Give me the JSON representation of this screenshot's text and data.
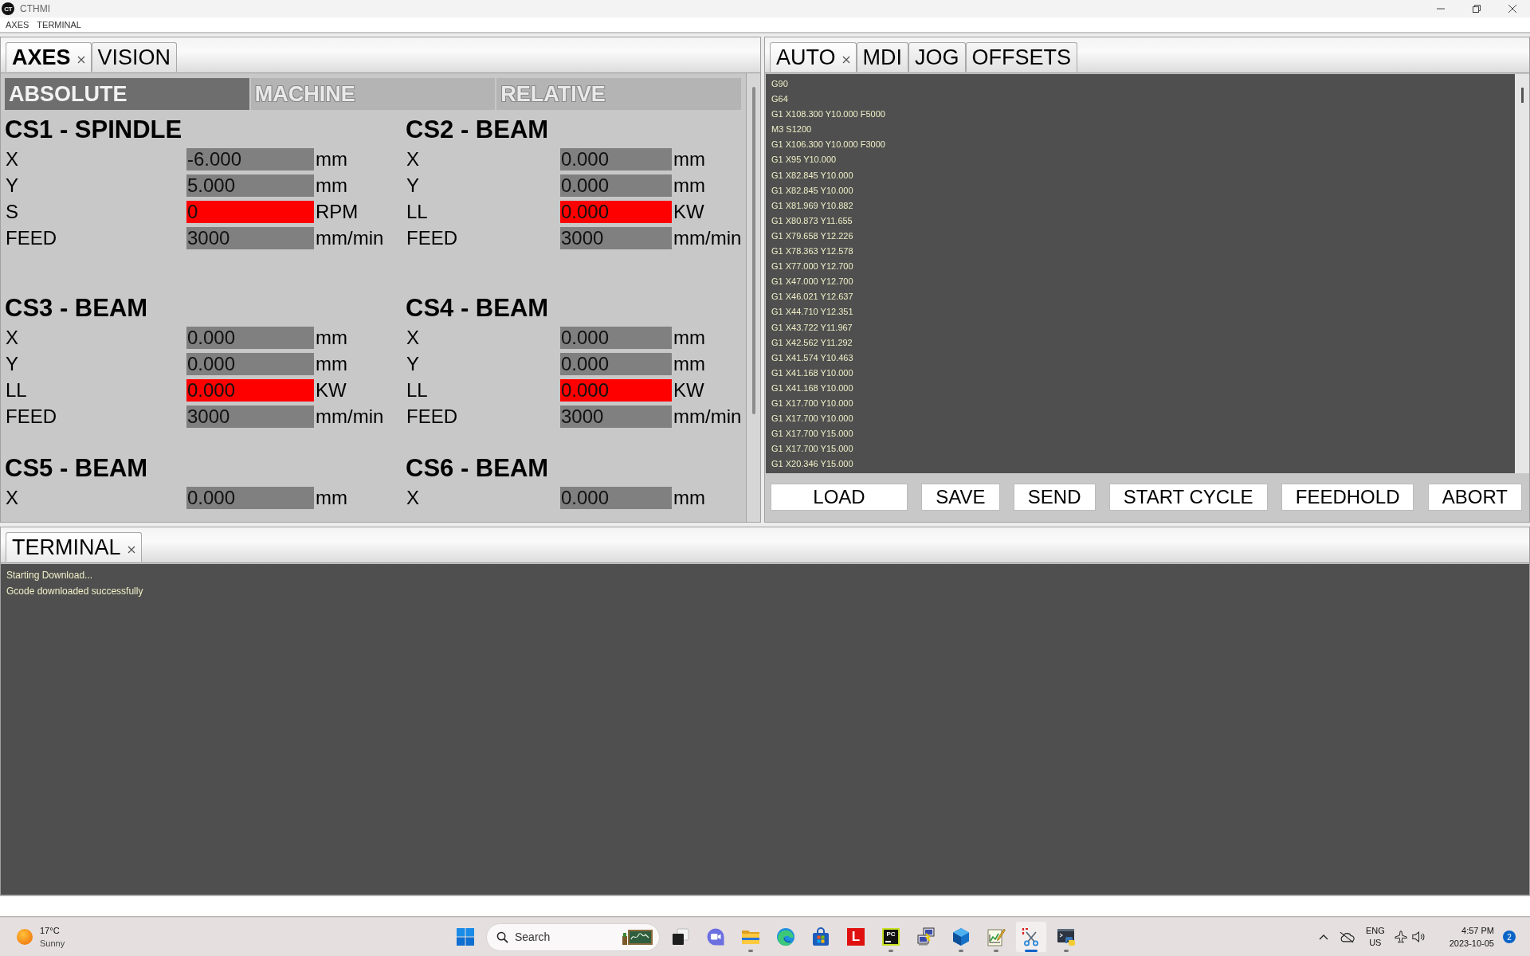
{
  "window": {
    "logo": "CT",
    "title": "CTHMI"
  },
  "menu": [
    "AXES",
    "TERMINAL"
  ],
  "axes_panel": {
    "active": true,
    "tabs": [
      {
        "label": "AXES",
        "selected": true
      },
      {
        "label": "VISION",
        "selected": false
      }
    ],
    "modes": [
      {
        "label": "ABSOLUTE",
        "selected": true
      },
      {
        "label": "MACHINE",
        "selected": false
      },
      {
        "label": "RELATIVE",
        "selected": false
      }
    ],
    "coordinate_systems": [
      {
        "title": "CS1 - SPINDLE",
        "rows": [
          {
            "label": "X",
            "value": "-6.000",
            "unit": "mm",
            "alarm": false
          },
          {
            "label": "Y",
            "value": "5.000",
            "unit": "mm",
            "alarm": false
          },
          {
            "label": "S",
            "value": "0",
            "unit": "RPM",
            "alarm": true
          },
          {
            "label": "FEED",
            "value": "3000",
            "unit": "mm/min",
            "alarm": false
          }
        ]
      },
      {
        "title": "CS2 - BEAM",
        "rows": [
          {
            "label": "X",
            "value": "0.000",
            "unit": "mm",
            "alarm": false
          },
          {
            "label": "Y",
            "value": "0.000",
            "unit": "mm",
            "alarm": false
          },
          {
            "label": "LL",
            "value": "0.000",
            "unit": "KW",
            "alarm": true
          },
          {
            "label": "FEED",
            "value": "3000",
            "unit": "mm/min",
            "alarm": false
          }
        ]
      },
      {
        "title": "CS3 - BEAM",
        "rows": [
          {
            "label": "X",
            "value": "0.000",
            "unit": "mm",
            "alarm": false
          },
          {
            "label": "Y",
            "value": "0.000",
            "unit": "mm",
            "alarm": false
          },
          {
            "label": "LL",
            "value": "0.000",
            "unit": "KW",
            "alarm": true
          },
          {
            "label": "FEED",
            "value": "3000",
            "unit": "mm/min",
            "alarm": false
          }
        ]
      },
      {
        "title": "CS4 - BEAM",
        "rows": [
          {
            "label": "X",
            "value": "0.000",
            "unit": "mm",
            "alarm": false
          },
          {
            "label": "Y",
            "value": "0.000",
            "unit": "mm",
            "alarm": false
          },
          {
            "label": "LL",
            "value": "0.000",
            "unit": "KW",
            "alarm": true
          },
          {
            "label": "FEED",
            "value": "3000",
            "unit": "mm/min",
            "alarm": false
          }
        ]
      },
      {
        "title": "CS5 - BEAM",
        "rows": [
          {
            "label": "X",
            "value": "0.000",
            "unit": "mm",
            "alarm": false
          }
        ]
      },
      {
        "title": "CS6 - BEAM",
        "rows": [
          {
            "label": "X",
            "value": "0.000",
            "unit": "mm",
            "alarm": false
          }
        ]
      }
    ]
  },
  "program_panel": {
    "active": false,
    "tabs": [
      {
        "label": "AUTO",
        "selected": true
      },
      {
        "label": "MDI",
        "selected": false
      },
      {
        "label": "JOG",
        "selected": false
      },
      {
        "label": "OFFSETS",
        "selected": false
      }
    ],
    "gcode_lines": [
      "G90",
      "G64",
      "G1 X108.300 Y10.000 F5000",
      "M3 S1200",
      "G1 X106.300 Y10.000 F3000",
      "G1 X95 Y10.000",
      "G1 X82.845 Y10.000",
      "G1 X82.845 Y10.000",
      "G1 X81.969 Y10.882",
      "G1 X80.873 Y11.655",
      "G1 X79.658 Y12.226",
      "G1 X78.363 Y12.578",
      "G1 X77.000 Y12.700",
      "G1 X47.000 Y12.700",
      "G1 X46.021 Y12.637",
      "G1 X44.710 Y12.351",
      "G1 X43.722 Y11.967",
      "G1 X42.562 Y11.292",
      "G1 X41.574 Y10.463",
      "G1 X41.168 Y10.000",
      "G1 X41.168 Y10.000",
      "G1 X17.700 Y10.000",
      "G1 X17.700 Y10.000",
      "G1 X17.700 Y15.000",
      "G1 X17.700 Y15.000",
      "G1 X20.346 Y15.000"
    ],
    "buttons": [
      "LOAD",
      "SAVE",
      "SEND",
      "START CYCLE",
      "FEEDHOLD",
      "ABORT"
    ]
  },
  "terminal_panel": {
    "active": false,
    "tabs": [
      {
        "label": "TERMINAL",
        "selected": true
      }
    ],
    "lines": [
      "Starting Download...",
      "Gcode downloaded successfully"
    ]
  },
  "taskbar": {
    "weather": {
      "temperature": "17°C",
      "condition": "Sunny"
    },
    "search": {
      "placeholder": "Search"
    },
    "apps": [
      {
        "kind": "task-view",
        "running": false,
        "selected": false
      },
      {
        "kind": "chat",
        "running": false,
        "selected": false
      },
      {
        "kind": "folder",
        "running": true,
        "selected": false
      },
      {
        "kind": "browser",
        "running": false,
        "selected": false
      },
      {
        "kind": "store",
        "running": false,
        "selected": false
      },
      {
        "kind": "lettermark",
        "glyph": "L",
        "running": false,
        "selected": false
      },
      {
        "kind": "ide",
        "glyph": "PC",
        "running": true,
        "selected": false
      },
      {
        "kind": "network",
        "running": false,
        "selected": false
      },
      {
        "kind": "cube",
        "running": true,
        "selected": false
      },
      {
        "kind": "editor",
        "running": true,
        "selected": false
      },
      {
        "kind": "snipping",
        "running": true,
        "selected": true
      },
      {
        "kind": "terminal",
        "running": true,
        "selected": false
      }
    ],
    "tray": {
      "language": "ENG",
      "region": "US",
      "time": "4:57 PM",
      "date": "2023-10-05",
      "notifications": "2"
    }
  }
}
